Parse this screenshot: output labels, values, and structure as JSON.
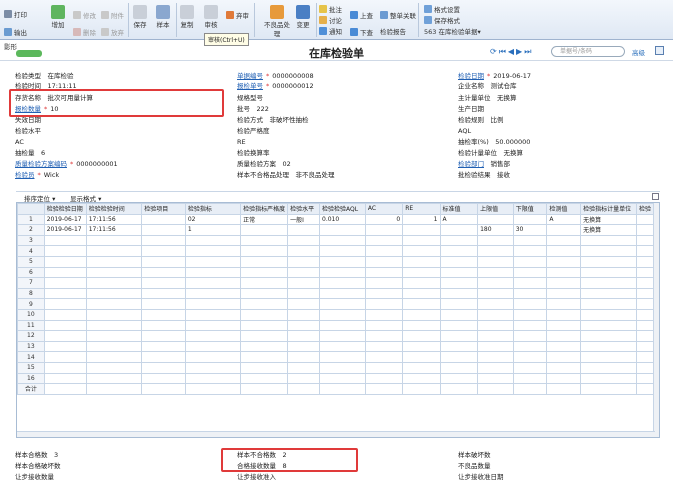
{
  "toolbar": {
    "print": "打印",
    "export": "输出",
    "add": "增加",
    "modify": "修改",
    "delete": "删除",
    "attach": "附件",
    "abandon": "放弃",
    "save": "保存",
    "sample": "样本",
    "copy": "复制",
    "audit": "审核",
    "submit": "弃审",
    "change": "变更",
    "nonconform": "不良品处理",
    "annotate": "批注",
    "discuss": "讨论",
    "notify": "通知",
    "up": "上查",
    "down": "下查",
    "link": "整单关联",
    "report": "检验报告",
    "format": "格式设置",
    "saveformat": "保存格式",
    "template": "563 在库检验单据▾",
    "tooltip": "审核(Ctrl+U)"
  },
  "subbar": {
    "tag": "影形",
    "title": "在库检验单",
    "search_placeholder": "单据号/条码",
    "advanced": "高级"
  },
  "form": {
    "check_type_label": "检验类型",
    "check_type": "在库检验",
    "check_time_label": "检验时间",
    "check_time": "17:11:11",
    "stock_name_label": "存货名称",
    "stock_name": "批次可用量计算",
    "report_qty_label": "报检数量",
    "report_qty": "10",
    "loss_label": "失效日期",
    "level_label": "检验水平",
    "level": "",
    "ac_label": "AC",
    "sample_qty_label": "抽检量",
    "sample_qty": "6",
    "scheme_label": "质量检验方案编码",
    "scheme": "0000000001",
    "inspector_label": "检验员",
    "inspector": "Wick",
    "doc_no_label": "单据编号",
    "doc_no": "0000000008",
    "report_no_label": "报检单号",
    "report_no": "0000000012",
    "spec_label": "规格型号",
    "batch_label": "批号",
    "batch": "222",
    "method_label": "检验方式",
    "method": "非破坏性抽检",
    "strict_label": "检验严格度",
    "re_label": "RE",
    "calc_label": "检验换算率",
    "qscheme_label": "质量检验方案",
    "qscheme": "02",
    "sample_ng_label": "样本不合格品处理",
    "sample_ng": "非不良品处理",
    "check_date_label": "检验日期",
    "check_date": "2019-06-17",
    "company_label": "企业名称",
    "company": "测试仓库",
    "unit_label": "主计量单位",
    "unit": "无换算",
    "prod_date_label": "生产日期",
    "mode_label": "检验规则",
    "mode": "比例",
    "aql_label": "AQL",
    "rate_label": "抽检率(%)",
    "rate": "50.000000",
    "cunit_label": "检验计量单位",
    "cunit": "无换算",
    "dept_label": "检验部门",
    "dept": "销售部",
    "result_label": "批检验结果",
    "result": "接收"
  },
  "grid": {
    "toolbar_sort": "排序定位 ▾",
    "toolbar_display": "显示格式 ▾",
    "columns": [
      "",
      "检验检验日期",
      "检验检验时间",
      "检验项目",
      "检验指标",
      "检验指标严格度",
      "检验水平",
      "检验检验AQL",
      "AC",
      "RE",
      "标准值",
      "上限值",
      "下限值",
      "检测值",
      "检验指标计量单位",
      "检验"
    ],
    "rows": [
      [
        "1",
        "2019-06-17",
        "17:11:56",
        "",
        "02",
        "正常",
        "一般I",
        "0.010",
        "0",
        "1",
        "A",
        "",
        "",
        "A",
        "无换算",
        ""
      ],
      [
        "2",
        "2019-06-17",
        "17:11:56",
        "",
        "1",
        "",
        "",
        "",
        "",
        "",
        "",
        "180",
        "30",
        "",
        "无换算",
        ""
      ]
    ],
    "empty_rows": [
      "3",
      "4",
      "5",
      "6",
      "7",
      "8",
      "9",
      "10",
      "11",
      "12",
      "13",
      "14",
      "15",
      "16"
    ],
    "total_label": "合计"
  },
  "footer": {
    "l1": "样本合格数",
    "l1v": "3",
    "l2": "样本合格破坏数",
    "l3": "让步接收数量",
    "m1": "样本不合格数",
    "m1v": "2",
    "m2": "合格接收数量",
    "m2v": "8",
    "m3": "让步接收准入",
    "r1": "样本破坏数",
    "r2": "不良品数量",
    "r3": "让步接收准日期"
  }
}
